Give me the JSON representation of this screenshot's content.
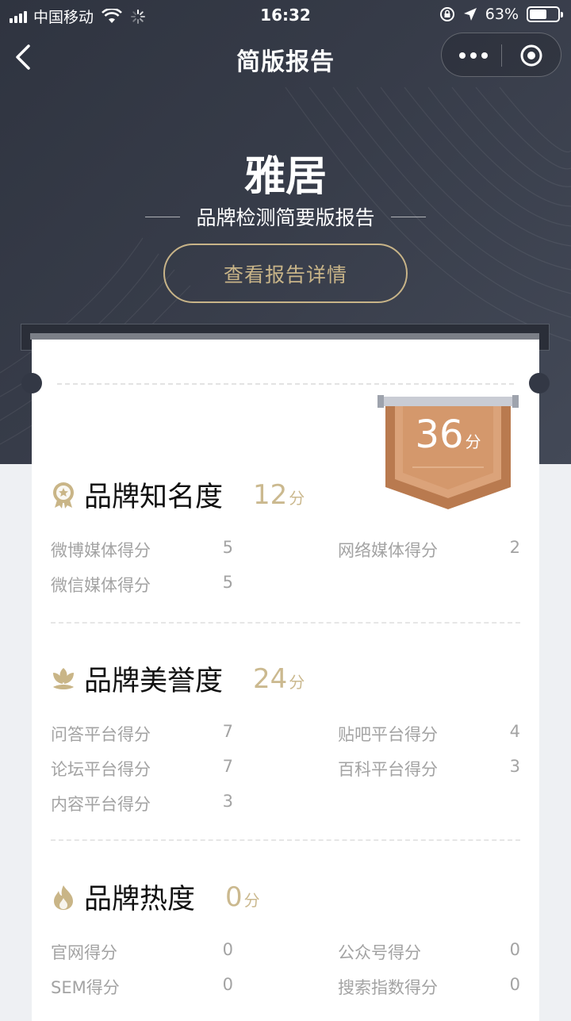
{
  "status_bar": {
    "carrier": "中国移动",
    "time": "16:32",
    "battery_percent": "63%",
    "battery_level": 0.63
  },
  "nav": {
    "title": "简版报告"
  },
  "hero": {
    "brand_name": "雅居",
    "subtitle": "品牌检测简要版报告",
    "detail_button": "查看报告详情"
  },
  "total_score": {
    "value": "36",
    "unit": "分"
  },
  "sections": [
    {
      "title": "品牌知名度",
      "icon": "medal-icon",
      "score": "12",
      "unit": "分",
      "metrics": [
        {
          "label": "微博媒体得分",
          "value": "5"
        },
        {
          "label": "网络媒体得分",
          "value": "2"
        },
        {
          "label": "微信媒体得分",
          "value": "5"
        }
      ]
    },
    {
      "title": "品牌美誉度",
      "icon": "lotus-icon",
      "score": "24",
      "unit": "分",
      "metrics": [
        {
          "label": "问答平台得分",
          "value": "7"
        },
        {
          "label": "贴吧平台得分",
          "value": "4"
        },
        {
          "label": "论坛平台得分",
          "value": "7"
        },
        {
          "label": "百科平台得分",
          "value": "3"
        },
        {
          "label": "内容平台得分",
          "value": "3"
        }
      ]
    },
    {
      "title": "品牌热度",
      "icon": "flame-icon",
      "score": "0",
      "unit": "分",
      "metrics": [
        {
          "label": "官网得分",
          "value": "0"
        },
        {
          "label": "公众号得分",
          "value": "0"
        },
        {
          "label": "SEM得分",
          "value": "0"
        },
        {
          "label": "搜索指数得分",
          "value": "0"
        }
      ]
    }
  ],
  "colors": {
    "accent_gold": "#c8b488",
    "ribbon_bronze": "#c98a5e",
    "hero_bg": "#343945"
  }
}
